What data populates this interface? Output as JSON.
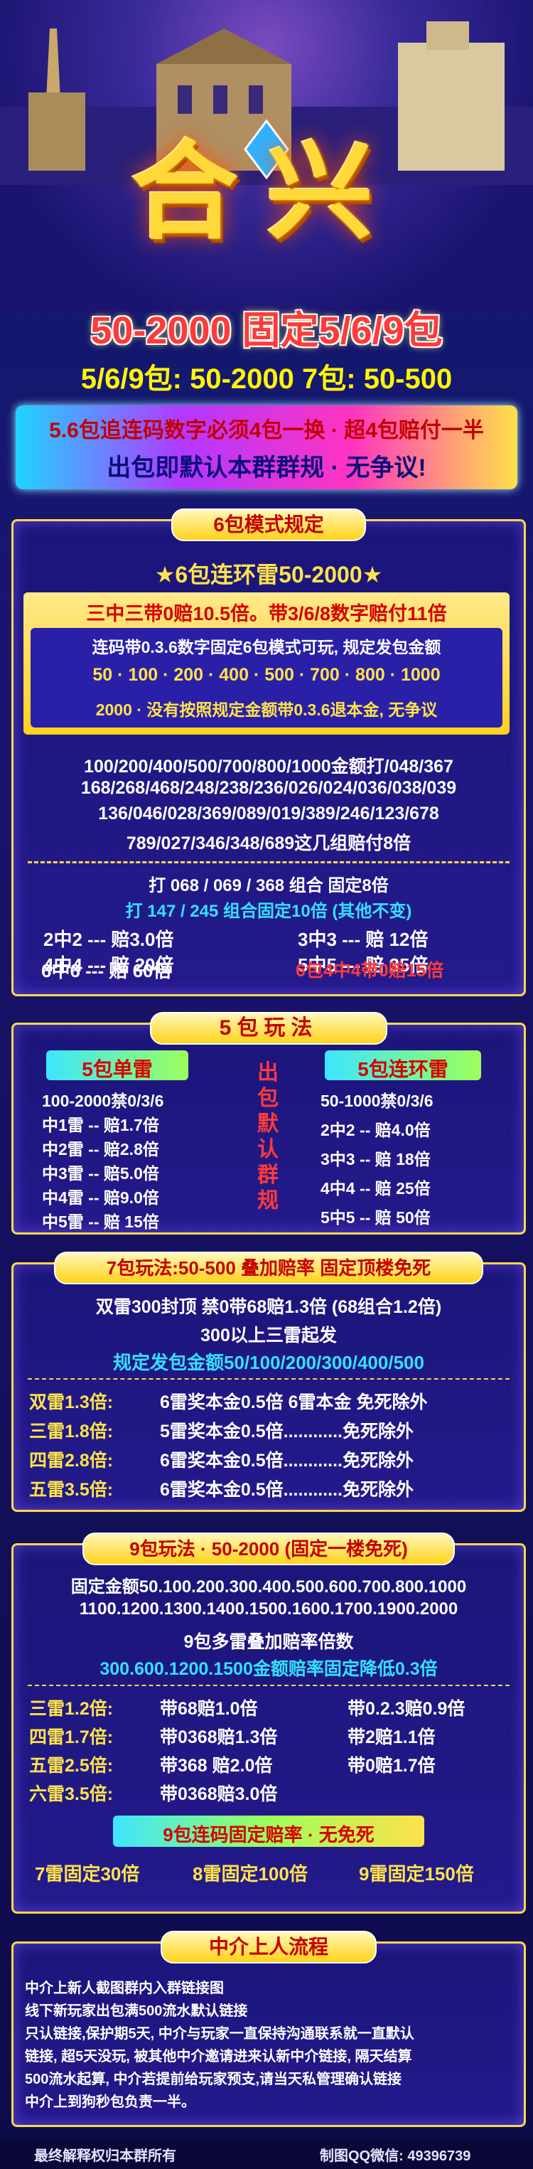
{
  "title": "合兴",
  "headline": "50-2000  固定5/6/9包",
  "subheadline": "5/6/9包: 50-2000    7包: 50-500",
  "banner": {
    "line1": "5.6包追连码数字必须4包一换 · 超4包赔付一半",
    "line2": "出包即默认本群群规 · 无争议!"
  },
  "six": {
    "title": "6包模式规定",
    "subtitle": "★6包连环雷50-2000★",
    "yellow_line": "三中三带0赔10.5倍。带3/6/8数字赔付11倍",
    "white_lines": [
      "连码带0.3.6数字固定6包模式可玩, 规定发包金额",
      "50 · 100 · 200 · 400 · 500 · 700 · 800 · 1000",
      "2000 · 没有按照规定金额带0.3.6退本金, 无争议"
    ],
    "combo_lines": [
      "100/200/400/500/700/800/1000金额打/048/367",
      "168/268/468/248/238/236/026/024/036/038/039",
      "136/046/028/369/089/019/389/246/123/678",
      "789/027/346/348/689这几组赔付8倍"
    ],
    "fixed8": "打 068 / 069 / 368 组合 固定8倍",
    "fixed10": "打 147 / 245 组合固定10倍 (其他不变)",
    "odds_left": [
      "2中2 --- 赔3.0倍",
      "4中4 --- 赔 20倍",
      "6中6 --- 赔 60倍"
    ],
    "odds_right": [
      "3中3 --- 赔 12倍",
      "5中5 --- 赔 35倍",
      "6包4中4带0赔15倍"
    ]
  },
  "five": {
    "title": "5包玩法",
    "left_title": "5包单雷",
    "left_lines": [
      "100-2000禁0/3/6",
      "中1雷 -- 赔1.7倍",
      "中2雷 -- 赔2.8倍",
      "中3雷 -- 赔5.0倍",
      "中4雷 -- 赔9.0倍",
      "中5雷 -- 赔 15倍"
    ],
    "center_vertical": [
      "出",
      "包",
      "默",
      "认",
      "群",
      "规"
    ],
    "right_title": "5包连环雷",
    "right_lines": [
      "50-1000禁0/3/6",
      "2中2 -- 赔4.0倍",
      "3中3 -- 赔 18倍",
      "4中4 -- 赔 25倍",
      "5中5 -- 赔 50倍"
    ]
  },
  "seven": {
    "title": "7包玩法:50-500 叠加赔率 固定顶楼免死",
    "line1": "双雷300封顶 禁0带68赔1.3倍 (68组合1.2倍)",
    "line2": "300以上三雷起发",
    "line3": "规定发包金额50/100/200/300/400/500",
    "rows": [
      {
        "a": "双雷1.3倍:",
        "b": "6雷奖本金0.5倍  6雷本金  免死除外"
      },
      {
        "a": "三雷1.8倍:",
        "b": "5雷奖本金0.5倍............免死除外"
      },
      {
        "a": "四雷2.8倍:",
        "b": "6雷奖本金0.5倍............免死除外"
      },
      {
        "a": "五雷3.5倍:",
        "b": "6雷奖本金0.5倍............免死除外"
      }
    ]
  },
  "nine": {
    "title": "9包玩法 · 50-2000 (固定一楼免死)",
    "amount1": "固定金额50.100.200.300.400.500.600.700.800.1000",
    "amount2": "1100.1200.1300.1400.1500.1600.1700.1900.2000",
    "multi": "9包多雷叠加赔率倍数",
    "reduce": "300.600.1200.1500金额赔率固定降低0.3倍",
    "rows": [
      {
        "a": "三雷1.2倍:",
        "b": "带68赔1.0倍",
        "c": "带0.2.3赔0.9倍"
      },
      {
        "a": "四雷1.7倍:",
        "b": "带0368赔1.3倍",
        "c": "带2赔1.1倍"
      },
      {
        "a": "五雷2.5倍:",
        "b": "带368  赔2.0倍",
        "c": "带0赔1.7倍"
      },
      {
        "a": "六雷3.5倍:",
        "b": "带0368赔3.0倍",
        "c": ""
      }
    ],
    "fixed_title": "9包连码固定赔率 · 无免死",
    "fixed": [
      "7雷固定30倍",
      "8雷固定100倍",
      "9雷固定150倍"
    ]
  },
  "agent": {
    "title": "中介上人流程",
    "lines": [
      "中介上新人截图群内入群链接图",
      "线下新玩家出包满500流水默认链接",
      "只认链接,保护期5天, 中介与玩家一直保持沟通联系就一直默认",
      "链接, 超5天没玩, 被其他中介邀请进来认新中介链接, 隔天结算",
      "500流水起算, 中介若提前给玩家预支,请当天私管理确认链接",
      "中介上到狗秒包负责一半。"
    ]
  },
  "footer": {
    "left": "最终解释权归本群所有",
    "right": "制图QQ微信: 49396739"
  }
}
